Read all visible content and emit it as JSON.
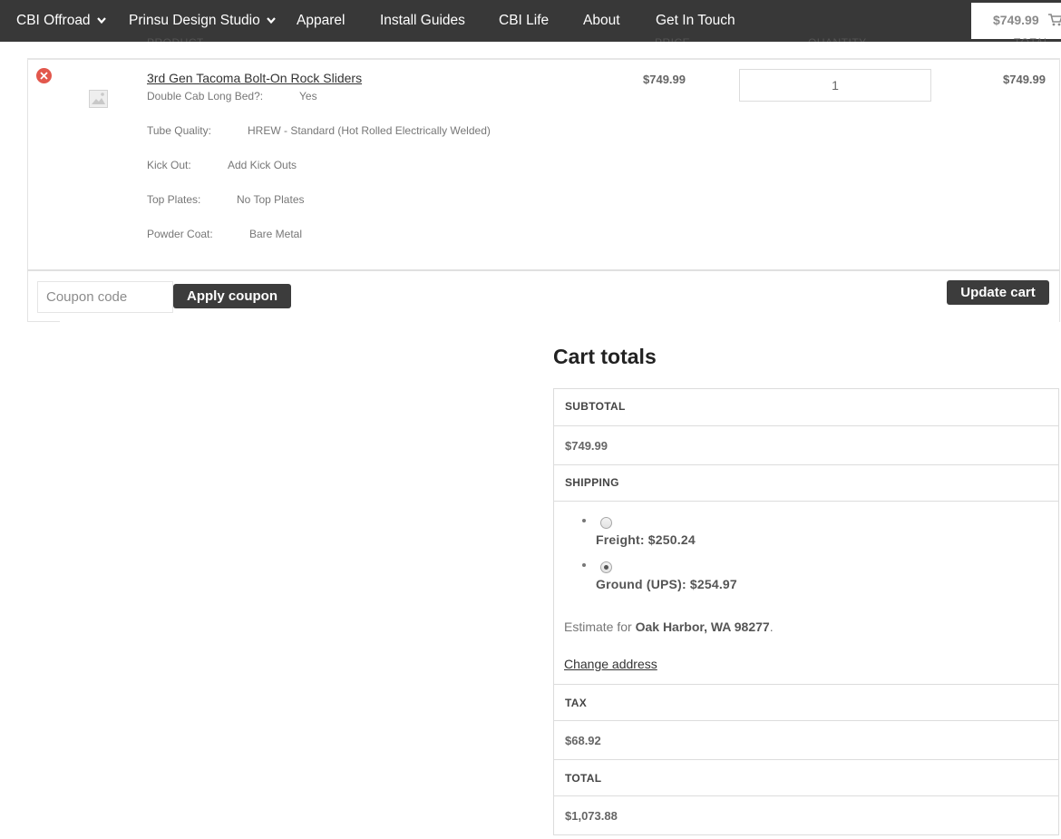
{
  "nav": {
    "items": [
      {
        "label": "CBI Offroad",
        "dropdown": true
      },
      {
        "label": "Prinsu Design Studio",
        "dropdown": true
      },
      {
        "label": "Apparel",
        "dropdown": false
      },
      {
        "label": "Install Guides",
        "dropdown": false
      },
      {
        "label": "CBI Life",
        "dropdown": false
      },
      {
        "label": "About",
        "dropdown": false
      },
      {
        "label": "Get In Touch",
        "dropdown": false
      }
    ],
    "cart_total": "$749.99",
    "cart_icon": "cart-icon"
  },
  "table_headers": {
    "product": "PRODUCT",
    "price": "PRICE",
    "quantity": "QUANTITY",
    "total": "TOTAL"
  },
  "cart_item": {
    "remove_icon": "remove-icon",
    "thumbnail_icon": "image-placeholder-icon",
    "name": "3rd Gen Tacoma Bolt-On Rock Sliders",
    "options": [
      {
        "label": "Double Cab Long Bed?:",
        "value": "Yes"
      },
      {
        "label": "Tube Quality:",
        "value": "HREW - Standard (Hot Rolled Electrically Welded)"
      },
      {
        "label": "Kick Out:",
        "value": "Add Kick Outs"
      },
      {
        "label": "Top Plates:",
        "value": "No Top Plates"
      },
      {
        "label": "Powder Coat:",
        "value": "Bare Metal"
      }
    ],
    "price": "$749.99",
    "quantity": "1",
    "total": "$749.99"
  },
  "coupon": {
    "placeholder": "Coupon code",
    "apply_label": "Apply coupon"
  },
  "update_label": "Update cart",
  "totals": {
    "title": "Cart totals",
    "subtotal_label": "SUBTOTAL",
    "subtotal_value": "$749.99",
    "shipping_label": "SHIPPING",
    "shipping_options": [
      {
        "label": "Freight: $250.24",
        "selected": false
      },
      {
        "label": "Ground (UPS): $254.97",
        "selected": true
      }
    ],
    "estimate_prefix": "Estimate for ",
    "estimate_location": "Oak Harbor, WA 98277",
    "estimate_suffix": ".",
    "change_address": "Change address",
    "tax_label": "TAX",
    "tax_value": "$68.92",
    "total_label": "TOTAL",
    "total_value": "$1,073.88"
  },
  "colors": {
    "nav_bg": "#383838",
    "button_bg": "#3c3c3c",
    "remove_red": "#e2574c"
  }
}
